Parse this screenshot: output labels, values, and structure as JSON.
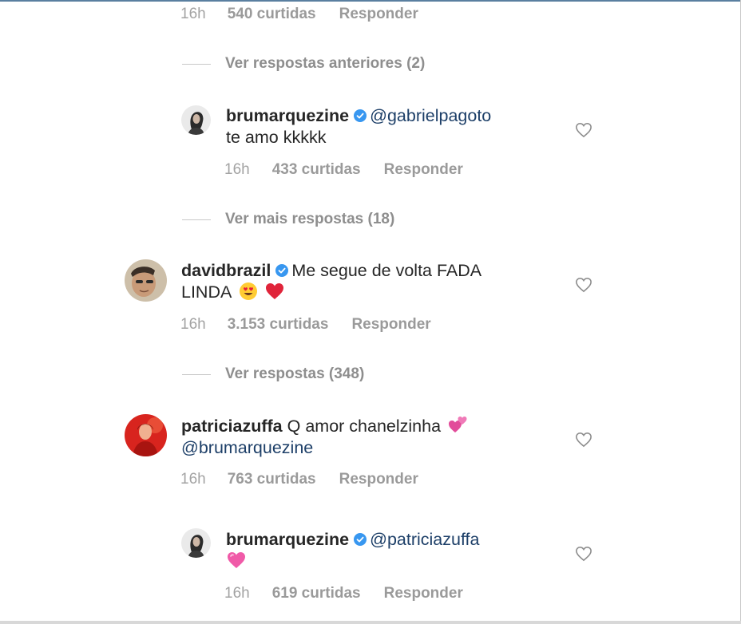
{
  "colors": {
    "text": "#262626",
    "meta": "#9a9a9a",
    "mention": "#1d3f68",
    "verified": "#3897f0",
    "red_heart": "#e0243a",
    "pink_heart": "#f05aa8"
  },
  "top_meta": {
    "time": "16h",
    "likes": "540 curtidas",
    "reply": "Responder"
  },
  "threads": [
    {
      "view_replies": "Ver respostas anteriores (2)",
      "reply": {
        "username": "brumarquezine",
        "verified": true,
        "mention": "@gabrielpagoto",
        "text": "te amo kkkkk",
        "time": "16h",
        "likes": "433 curtidas",
        "reply_label": "Responder"
      }
    },
    {
      "view_replies": "Ver mais respostas (18)"
    },
    {
      "comment": {
        "username": "davidbrazil",
        "verified": true,
        "text_line1": "Me segue de volta FADA",
        "text_line2": "LINDA",
        "emojis": [
          "smiling-face-with-heart-eyes",
          "red-heart"
        ],
        "time": "16h",
        "likes": "3.153 curtidas",
        "reply_label": "Responder"
      },
      "view_replies": "Ver respostas (348)"
    },
    {
      "comment": {
        "username": "patriciazuffa",
        "text_line1": "Q amor chanelzinha",
        "emoji": "two-hearts",
        "mention": "@brumarquezine",
        "time": "16h",
        "likes": "763 curtidas",
        "reply_label": "Responder"
      },
      "reply": {
        "username": "brumarquezine",
        "verified": true,
        "mention": "@patriciazuffa",
        "emoji": "pink-heart",
        "time": "16h",
        "likes": "619 curtidas",
        "reply_label": "Responder"
      }
    }
  ]
}
